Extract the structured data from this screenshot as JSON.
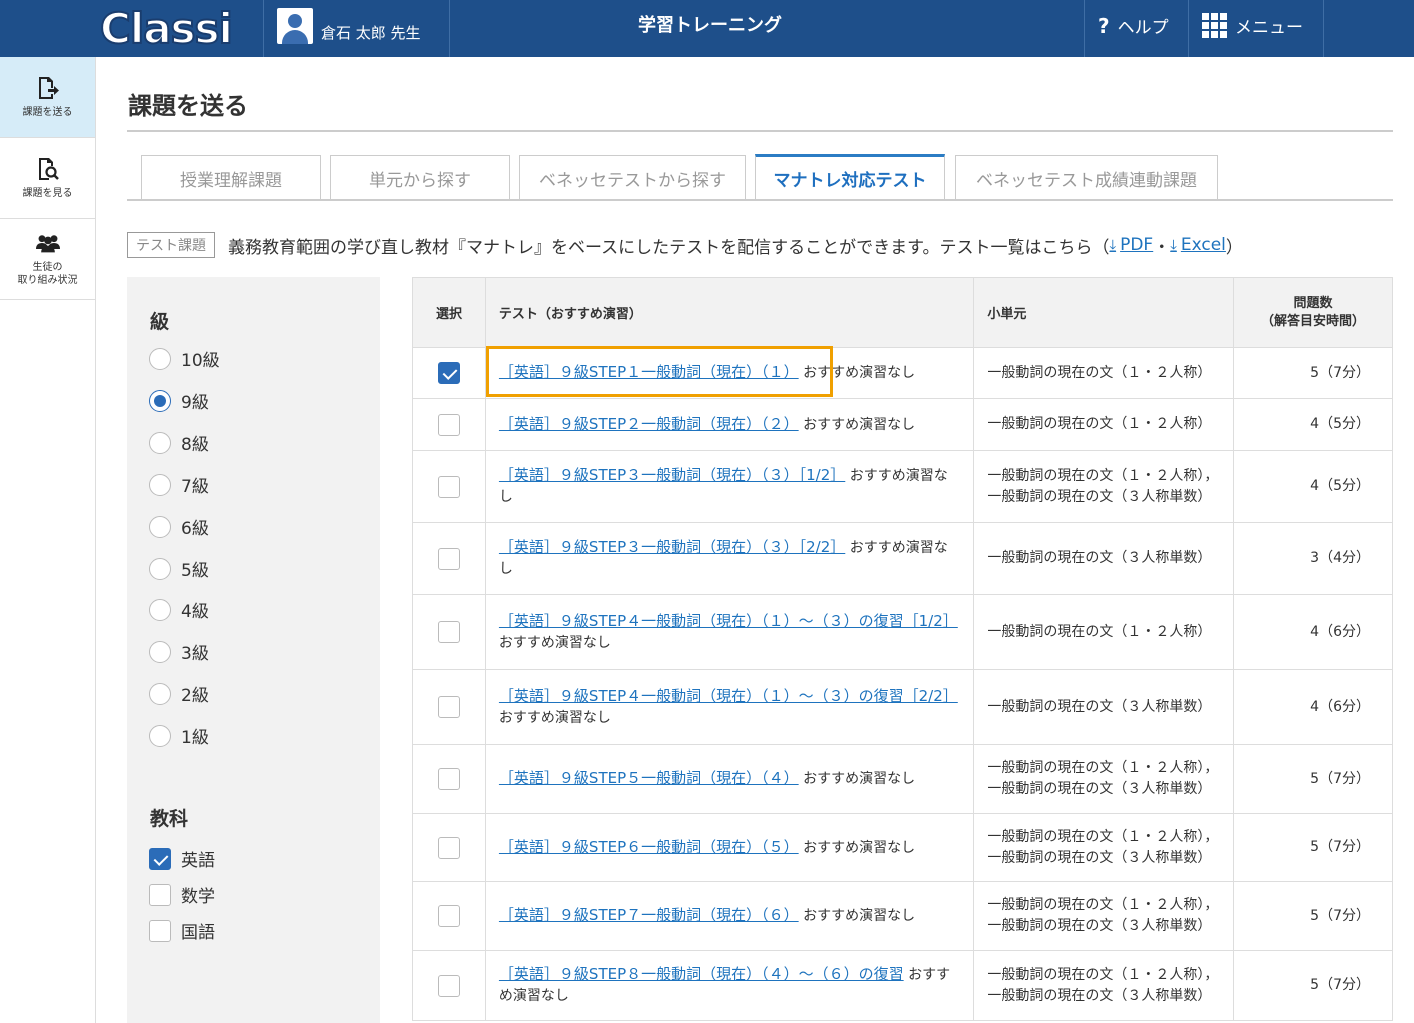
{
  "header": {
    "logo": "Classi",
    "user_name": "倉石 太郎 先生",
    "app_title": "学習トレーニング",
    "help_label": "ヘルプ",
    "menu_label": "メニュー"
  },
  "sidebar": {
    "items": [
      {
        "label": "課題を送る",
        "active": true,
        "icon": "send-document-icon"
      },
      {
        "label": "課題を見る",
        "active": false,
        "icon": "search-document-icon"
      },
      {
        "label_line1": "生徒の",
        "label_line2": "取り組み状況",
        "active": false,
        "icon": "group-icon"
      }
    ]
  },
  "page": {
    "title": "課題を送る",
    "tabs": [
      {
        "label": "授業理解課題",
        "active": false
      },
      {
        "label": "単元から探す",
        "active": false
      },
      {
        "label": "ベネッセテストから探す",
        "active": false
      },
      {
        "label": "マナトレ対応テスト",
        "active": true
      },
      {
        "label": "ベネッセテスト成績連動課題",
        "active": false
      }
    ],
    "desc_badge": "テスト課題",
    "desc_text": "義務教育範囲の学び直し教材『マナトレ』をベースにしたテストを配信することができます。テスト一覧はこちら（",
    "pdf_label": "PDF",
    "sep": "・",
    "excel_label": "Excel",
    "close_paren": "）"
  },
  "filter": {
    "grade_heading": "級",
    "grades": [
      "10級",
      "9級",
      "8級",
      "7級",
      "6級",
      "5級",
      "4級",
      "3級",
      "2級",
      "1級"
    ],
    "selected_grade": "9級",
    "subject_heading": "教科",
    "subjects": [
      {
        "label": "英語",
        "checked": true
      },
      {
        "label": "数学",
        "checked": false
      },
      {
        "label": "国語",
        "checked": false
      }
    ]
  },
  "table": {
    "headers": {
      "select": "選択",
      "test": "テスト（おすすめ演習）",
      "unit": "小単元",
      "count_line1": "問題数",
      "count_line2": "（解答目安時間）"
    },
    "rows": [
      {
        "checked": true,
        "link": "［英語］９級STEP１一般動詞（現在）（１）",
        "note": "おすすめ演習なし",
        "unit": [
          "一般動詞の現在の文（１・２人称）"
        ],
        "count": "5（7分）"
      },
      {
        "checked": false,
        "link": "［英語］９級STEP２一般動詞（現在）（２）",
        "note": "おすすめ演習なし",
        "unit": [
          "一般動詞の現在の文（１・２人称）"
        ],
        "count": "4（5分）"
      },
      {
        "checked": false,
        "link": "［英語］９級STEP３一般動詞（現在）（３）［1/2］",
        "note": "おすすめ演習なし",
        "unit": [
          "一般動詞の現在の文（１・２人称），",
          "一般動詞の現在の文（３人称単数）"
        ],
        "count": "4（5分）"
      },
      {
        "checked": false,
        "link": "［英語］９級STEP３一般動詞（現在）（３）［2/2］",
        "note": "おすすめ演習なし",
        "unit": [
          "一般動詞の現在の文（３人称単数）"
        ],
        "count": "3（4分）"
      },
      {
        "checked": false,
        "link": "［英語］９級STEP４一般動詞（現在）（１）～（３）の復習［1/2］",
        "note": "おすすめ演習なし",
        "unit": [
          "一般動詞の現在の文（１・２人称）"
        ],
        "count": "4（6分）"
      },
      {
        "checked": false,
        "link": "［英語］９級STEP４一般動詞（現在）（１）～（３）の復習［2/2］",
        "note": "おすすめ演習なし",
        "unit": [
          "一般動詞の現在の文（３人称単数）"
        ],
        "count": "4（6分）"
      },
      {
        "checked": false,
        "link": "［英語］９級STEP５一般動詞（現在）（４）",
        "note": "おすすめ演習なし",
        "unit": [
          "一般動詞の現在の文（１・２人称），",
          "一般動詞の現在の文（３人称単数）"
        ],
        "count": "5（7分）"
      },
      {
        "checked": false,
        "link": "［英語］９級STEP６一般動詞（現在）（５）",
        "note": "おすすめ演習なし",
        "unit": [
          "一般動詞の現在の文（１・２人称），",
          "一般動詞の現在の文（３人称単数）"
        ],
        "count": "5（7分）"
      },
      {
        "checked": false,
        "link": "［英語］９級STEP７一般動詞（現在）（６）",
        "note": "おすすめ演習なし",
        "unit": [
          "一般動詞の現在の文（１・２人称），",
          "一般動詞の現在の文（３人称単数）"
        ],
        "count": "5（7分）"
      },
      {
        "checked": false,
        "link": "［英語］９級STEP８一般動詞（現在）（４）～（６）の復習",
        "note": "おすすめ演習なし",
        "unit": [
          "一般動詞の現在の文（１・２人称），",
          "一般動詞の現在の文（３人称単数）"
        ],
        "count": "5（7分）"
      }
    ]
  },
  "colors": {
    "header_bg": "#1e4f8a",
    "accent": "#2b6cb8",
    "link": "#1e73be",
    "highlight": "#f0a000"
  }
}
